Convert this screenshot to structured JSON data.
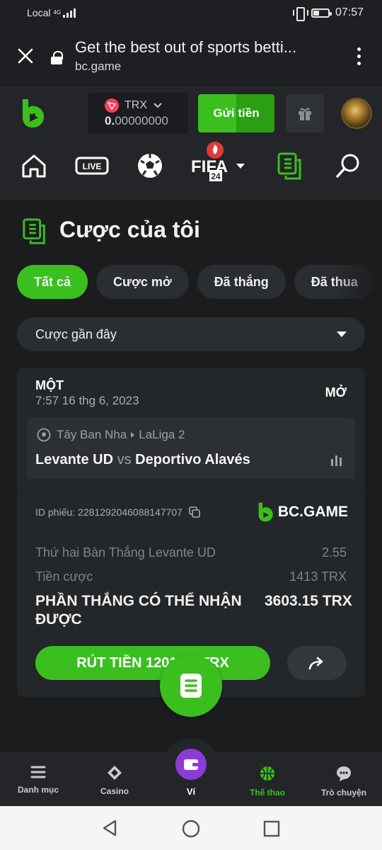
{
  "status_bar": {
    "carrier": "Local",
    "network": "4G",
    "time": "07:57",
    "battery_fraction": 0.35
  },
  "browser": {
    "title": "Get the best out of sports betti...",
    "domain": "bc.game"
  },
  "header": {
    "currency": "TRX",
    "balance_int": "0.",
    "balance_dec": "00000000",
    "deposit_label": "Gửi tiền"
  },
  "nav_icons": [
    "home-icon",
    "live-icon",
    "soccer-ball-icon",
    "fifa24-icon",
    "my-bets-icon",
    "search-icon"
  ],
  "nav": {
    "live_label": "LIVE",
    "fifa_label": "FIFA",
    "fifa_year": "24"
  },
  "page": {
    "title": "Cược của tôi"
  },
  "filters": [
    {
      "label": "Tất cả",
      "active": true
    },
    {
      "label": "Cược mở",
      "active": false
    },
    {
      "label": "Đã thắng",
      "active": false
    },
    {
      "label": "Đã thua",
      "active": false
    }
  ],
  "sort_select": {
    "value": "Cược gần đây"
  },
  "bet": {
    "type": "MỘT",
    "datetime": "7:57 16 thg 6, 2023",
    "status": "MỞ",
    "country": "Tây Ban Nha",
    "league": "LaLiga 2",
    "home": "Levante UD",
    "vs": "vs",
    "away": "Deportivo Alavés",
    "ticket_label": "ID phiếu:",
    "ticket_id": "2281292046088147707",
    "brand": "BC.GAME",
    "selection": "Thứ hai Bàn Thắng Levante UD",
    "odds": "2.55",
    "stake_label": "Tiền cược",
    "stake": "1413 TRX",
    "payout_label": "PHẦN THẮNG CÓ THỂ NHẬN ĐƯỢC",
    "payout": "3603.15 TRX",
    "cashout_label": "RÚT TIỀN 1201.05 TRX"
  },
  "bottom_nav": [
    {
      "label": "Danh mục",
      "icon": "menu-icon"
    },
    {
      "label": "Casino",
      "icon": "casino-icon"
    },
    {
      "label": "Ví",
      "icon": "wallet-icon"
    },
    {
      "label": "Thể thao",
      "icon": "basketball-icon",
      "active": true
    },
    {
      "label": "Trò chuyện",
      "icon": "chat-icon"
    }
  ],
  "colors": {
    "accent": "#3bbf1f",
    "background": "#1a1c1e",
    "card": "#24272a",
    "wallet": "#8b3bd6"
  }
}
